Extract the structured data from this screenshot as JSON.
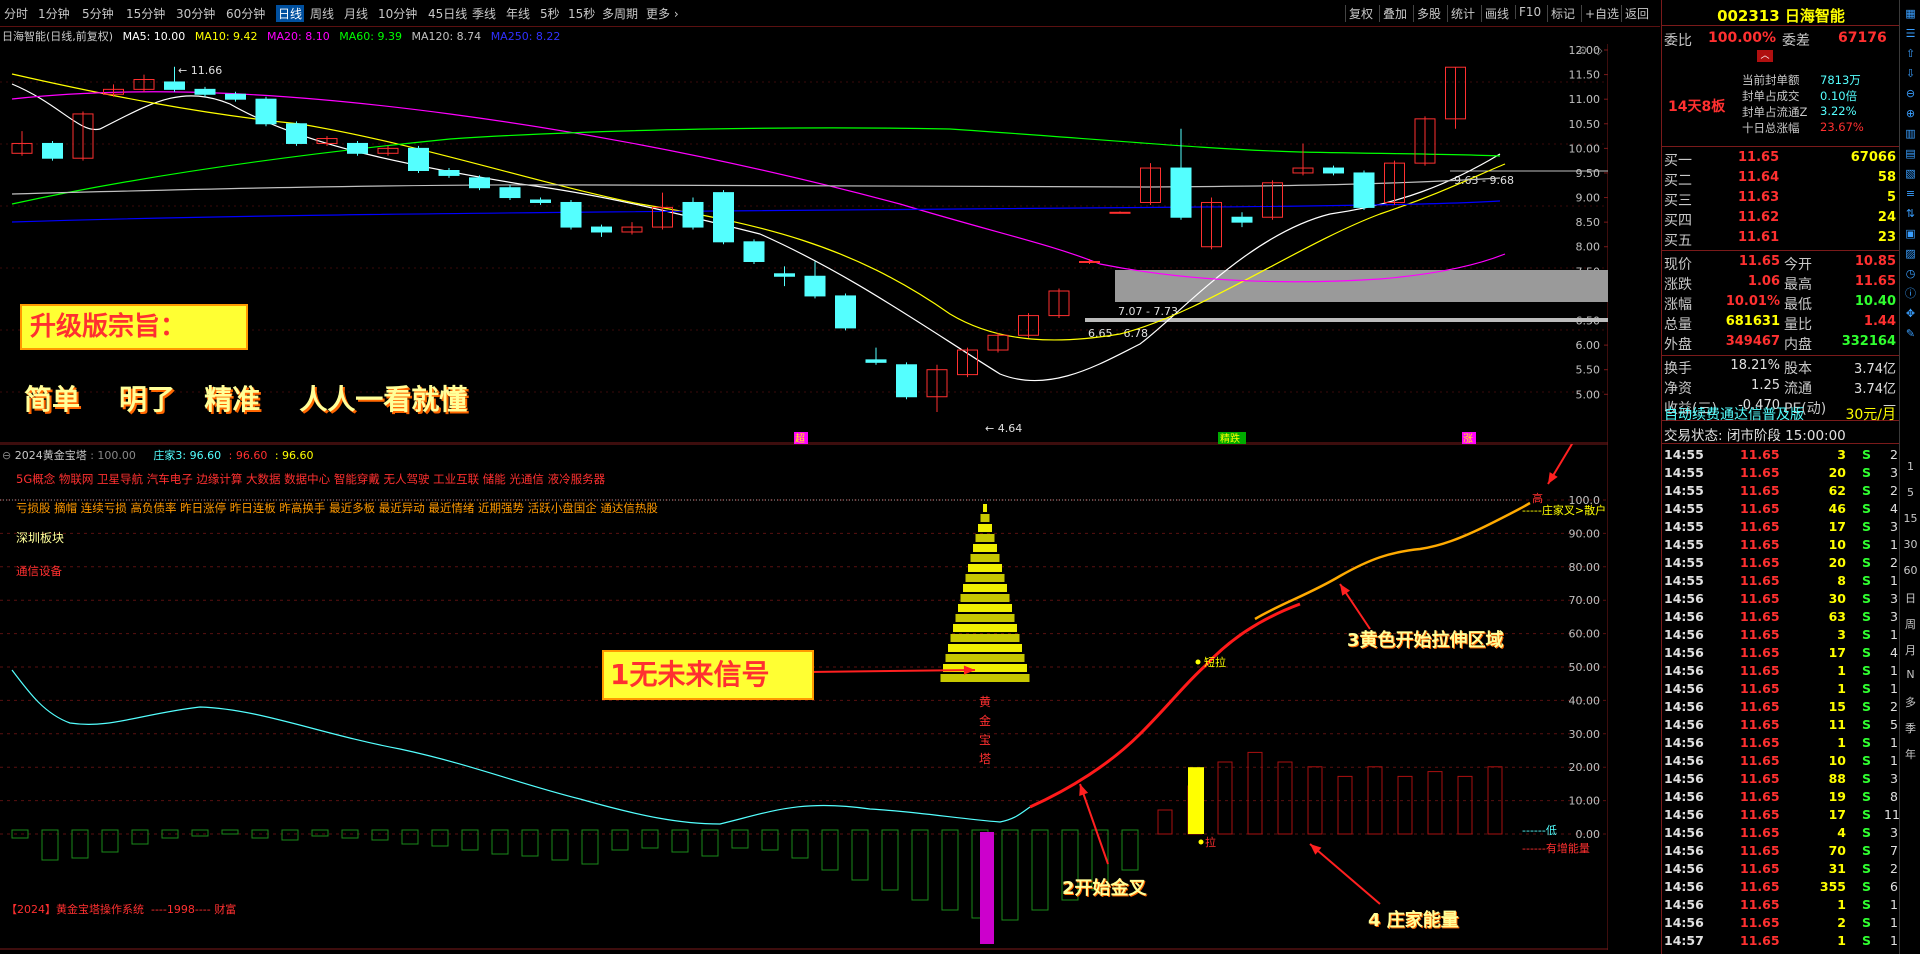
{
  "toolbar": {
    "periods": [
      "分时",
      "1分钟",
      "5分钟",
      "15分钟",
      "30分钟",
      "60分钟",
      "日线",
      "周线",
      "月线",
      "10分钟",
      "45日线",
      "季线",
      "年线",
      "5秒",
      "15秒",
      "多周期",
      "更多 ›"
    ],
    "active_period": "日线",
    "right_items": [
      "复权",
      "叠加",
      "多股",
      "统计",
      "画线",
      "F10",
      "标记",
      "+自选",
      "返回"
    ]
  },
  "main_legend": {
    "title": "日海智能(日线,前复权)",
    "ma5": "MA5: 10.00",
    "ma10": "MA10: 9.42",
    "ma20": "MA20: 8.10",
    "ma60": "MA60: 9.39",
    "ma120": "MA120: 8.74",
    "ma250": "MA250: 8.22"
  },
  "colors": {
    "ma5": "#ffffff",
    "ma10": "#ffff00",
    "ma20": "#ff00ff",
    "ma60": "#00ff00",
    "ma120": "#c0c0c0",
    "ma250": "#0000ff",
    "up": "#ff3030",
    "down": "#54ffff",
    "grid": "#7a1a1a"
  },
  "price_axis": [
    "12.00",
    "11.50",
    "11.00",
    "10.50",
    "10.00",
    "9.50",
    "9.00",
    "8.50",
    "8.00",
    "7.50",
    "7.00",
    "6.50",
    "6.00",
    "5.50",
    "5.00"
  ],
  "main_annotations": {
    "high_label": "11.66",
    "low_label": "4.64",
    "zone1": "7.07 - 7.73",
    "zone2": "6.65 - 6.78",
    "zone3": "9.63 - 9.68",
    "marker1": "超",
    "marker2": "精跌",
    "marker3": "涨"
  },
  "promo": {
    "box_title": "升级版宗旨：",
    "slogan": "简单    明了   精准    人人一看就懂"
  },
  "sub_legend": {
    "name": "2024黄金宝塔",
    "val1": ": 100.00",
    "label2": "庄家3: 96.60",
    "val3": ": 96.60",
    "val4": ": 96.60"
  },
  "concepts": {
    "line1": "5G概念 物联网 卫星导航 汽车电子 边缘计算 大数据 数据中心 智能穿戴 无人驾驶 工业互联 储能 光通信 液冷服务器",
    "line2": "亏损股 摘帽 连续亏损 高负债率 昨日涨停 昨日连板 昨高换手 最近多板 最近异动 最近情绪 近期强势 活跃小盘国企 通达信热股",
    "line3": "深圳板块",
    "line4": "通信设备"
  },
  "sub_axis": [
    "100.0",
    "90.00",
    "80.00",
    "70.00",
    "60.00",
    "50.00",
    "40.00",
    "30.00",
    "20.00",
    "10.00",
    "0.00"
  ],
  "sub_annotations": {
    "pagoda_label": [
      "黄",
      "金",
      "宝",
      "塔"
    ],
    "box1": "1无未来信号",
    "arrow2": "2开始金叉",
    "arrow3": "3黄色开始拉伸区域",
    "arrow4": "4 庄家能量",
    "short_pull": "短拉",
    "pull": "拉",
    "top_label": "高",
    "cross_label": "庄家叉>散户",
    "low_label": "低",
    "energy_label": "有增能量",
    "footer": "【2024】黄金宝塔操作系统  ----1998---- 财富"
  },
  "stock": {
    "code": "002313",
    "name": "日海智能",
    "wei_bi_label": "委比",
    "wei_bi": "100.00%",
    "wei_cha_label": "委差",
    "wei_cha": "67176",
    "seal_rows": [
      {
        "label": "当前封单额",
        "value": "7813万"
      },
      {
        "label": "封单占成交",
        "value": "0.10倍"
      },
      {
        "label": "封单占流通Z",
        "value": "3.22%"
      },
      {
        "label": "十日总涨幅",
        "value": "23.67%"
      }
    ],
    "streak": "14天8板",
    "buys": [
      {
        "label": "买一",
        "price": "11.65",
        "vol": "67066"
      },
      {
        "label": "买二",
        "price": "11.64",
        "vol": "58"
      },
      {
        "label": "买三",
        "price": "11.63",
        "vol": "5"
      },
      {
        "label": "买四",
        "price": "11.62",
        "vol": "24"
      },
      {
        "label": "买五",
        "price": "11.61",
        "vol": "23"
      }
    ],
    "quote": [
      {
        "l1": "现价",
        "v1": "11.65",
        "l2": "今开",
        "v2": "10.85"
      },
      {
        "l1": "涨跌",
        "v1": "1.06",
        "l2": "最高",
        "v2": "11.65"
      },
      {
        "l1": "涨幅",
        "v1": "10.01%",
        "l2": "最低",
        "v2": "10.40"
      },
      {
        "l1": "总量",
        "v1": "681631",
        "l2": "量比",
        "v2": "1.44"
      },
      {
        "l1": "外盘",
        "v1": "349467",
        "l2": "内盘",
        "v2": "332164"
      }
    ],
    "fund": [
      {
        "l1": "换手",
        "v1": "18.21%",
        "l2": "股本",
        "v2": "3.74亿"
      },
      {
        "l1": "净资",
        "v1": "1.25",
        "l2": "流通",
        "v2": "3.74亿"
      },
      {
        "l1": "收益(三)",
        "v1": "-0.470",
        "l2": "PE(动)",
        "v2": "—"
      }
    ],
    "promo_line": "自动续费通达信普及版",
    "promo_price": "30元/月",
    "trade_state": "交易状态: 闭市阶段 15:00:00"
  },
  "ticks": [
    [
      "14:55",
      "11.65",
      "3",
      "S",
      "2"
    ],
    [
      "14:55",
      "11.65",
      "20",
      "S",
      "3"
    ],
    [
      "14:55",
      "11.65",
      "62",
      "S",
      "2"
    ],
    [
      "14:55",
      "11.65",
      "46",
      "S",
      "4"
    ],
    [
      "14:55",
      "11.65",
      "17",
      "S",
      "3"
    ],
    [
      "14:55",
      "11.65",
      "10",
      "S",
      "1"
    ],
    [
      "14:55",
      "11.65",
      "20",
      "S",
      "2"
    ],
    [
      "14:55",
      "11.65",
      "8",
      "S",
      "1"
    ],
    [
      "14:56",
      "11.65",
      "30",
      "S",
      "3"
    ],
    [
      "14:56",
      "11.65",
      "63",
      "S",
      "3"
    ],
    [
      "14:56",
      "11.65",
      "3",
      "S",
      "1"
    ],
    [
      "14:56",
      "11.65",
      "17",
      "S",
      "4"
    ],
    [
      "14:56",
      "11.65",
      "1",
      "S",
      "1"
    ],
    [
      "14:56",
      "11.65",
      "1",
      "S",
      "1"
    ],
    [
      "14:56",
      "11.65",
      "15",
      "S",
      "2"
    ],
    [
      "14:56",
      "11.65",
      "11",
      "S",
      "5"
    ],
    [
      "14:56",
      "11.65",
      "1",
      "S",
      "1"
    ],
    [
      "14:56",
      "11.65",
      "10",
      "S",
      "1"
    ],
    [
      "14:56",
      "11.65",
      "88",
      "S",
      "3"
    ],
    [
      "14:56",
      "11.65",
      "19",
      "S",
      "8"
    ],
    [
      "14:56",
      "11.65",
      "17",
      "S",
      "11"
    ],
    [
      "14:56",
      "11.65",
      "4",
      "S",
      "3"
    ],
    [
      "14:56",
      "11.65",
      "70",
      "S",
      "7"
    ],
    [
      "14:56",
      "11.65",
      "31",
      "S",
      "2"
    ],
    [
      "14:56",
      "11.65",
      "355",
      "S",
      "6"
    ],
    [
      "14:56",
      "11.65",
      "1",
      "S",
      "1"
    ],
    [
      "14:56",
      "11.65",
      "2",
      "S",
      "1"
    ],
    [
      "14:57",
      "11.65",
      "1",
      "S",
      "1"
    ]
  ],
  "far_right": [
    "1",
    "5",
    "15",
    "30",
    "60",
    "日",
    "周",
    "月",
    "N",
    "多",
    "季",
    "年"
  ],
  "chart_data": {
    "type": "candlestick",
    "ma_legend": [
      "MA5",
      "MA10",
      "MA20",
      "MA60",
      "MA120",
      "MA250"
    ],
    "candles": [
      {
        "o": 9.9,
        "c": 10.1,
        "h": 10.35,
        "l": 9.85
      },
      {
        "o": 10.1,
        "c": 9.8,
        "h": 10.15,
        "l": 9.75
      },
      {
        "o": 9.8,
        "c": 10.7,
        "h": 10.75,
        "l": 9.75
      },
      {
        "o": 11.1,
        "c": 11.2,
        "h": 11.3,
        "l": 11.05
      },
      {
        "o": 11.2,
        "c": 11.4,
        "h": 11.5,
        "l": 11.15
      },
      {
        "o": 11.35,
        "c": 11.2,
        "h": 11.66,
        "l": 11.15
      },
      {
        "o": 11.2,
        "c": 11.1,
        "h": 11.25,
        "l": 11.05
      },
      {
        "o": 11.1,
        "c": 11.0,
        "h": 11.15,
        "l": 10.95
      },
      {
        "o": 11.0,
        "c": 10.5,
        "h": 11.05,
        "l": 10.45
      },
      {
        "o": 10.5,
        "c": 10.1,
        "h": 10.55,
        "l": 10.05
      },
      {
        "o": 10.1,
        "c": 10.2,
        "h": 10.25,
        "l": 10.05
      },
      {
        "o": 10.1,
        "c": 9.9,
        "h": 10.15,
        "l": 9.85
      },
      {
        "o": 9.9,
        "c": 10.0,
        "h": 10.05,
        "l": 9.85
      },
      {
        "o": 10.0,
        "c": 9.55,
        "h": 10.05,
        "l": 9.5
      },
      {
        "o": 9.55,
        "c": 9.45,
        "h": 9.6,
        "l": 9.4
      },
      {
        "o": 9.4,
        "c": 9.2,
        "h": 9.45,
        "l": 9.15
      },
      {
        "o": 9.2,
        "c": 9.0,
        "h": 9.25,
        "l": 8.95
      },
      {
        "o": 8.95,
        "c": 8.9,
        "h": 9.0,
        "l": 8.85
      },
      {
        "o": 8.9,
        "c": 8.4,
        "h": 8.95,
        "l": 8.35
      },
      {
        "o": 8.4,
        "c": 8.3,
        "h": 8.45,
        "l": 8.2
      },
      {
        "o": 8.3,
        "c": 8.4,
        "h": 8.5,
        "l": 8.25
      },
      {
        "o": 8.4,
        "c": 8.8,
        "h": 9.1,
        "l": 8.35
      },
      {
        "o": 8.9,
        "c": 8.4,
        "h": 9.0,
        "l": 8.35
      },
      {
        "o": 9.1,
        "c": 8.1,
        "h": 9.15,
        "l": 8.05
      },
      {
        "o": 8.1,
        "c": 7.7,
        "h": 8.15,
        "l": 7.65
      },
      {
        "o": 7.45,
        "c": 7.4,
        "h": 7.6,
        "l": 7.2
      },
      {
        "o": 7.4,
        "c": 7.0,
        "h": 7.7,
        "l": 6.95
      },
      {
        "o": 7.0,
        "c": 6.35,
        "h": 7.05,
        "l": 6.3
      },
      {
        "o": 5.7,
        "c": 5.65,
        "h": 5.95,
        "l": 5.6
      },
      {
        "o": 5.6,
        "c": 4.95,
        "h": 5.65,
        "l": 4.9
      },
      {
        "o": 4.95,
        "c": 5.5,
        "h": 5.6,
        "l": 4.64
      },
      {
        "o": 5.4,
        "c": 5.9,
        "h": 5.95,
        "l": 5.35
      },
      {
        "o": 5.9,
        "c": 6.2,
        "h": 6.25,
        "l": 5.85
      },
      {
        "o": 6.2,
        "c": 6.6,
        "h": 6.65,
        "l": 6.15
      },
      {
        "o": 6.6,
        "c": 7.1,
        "h": 7.15,
        "l": 6.55
      },
      {
        "o": 7.7,
        "c": 7.7,
        "h": 7.75,
        "l": 7.65
      },
      {
        "o": 8.7,
        "c": 8.7,
        "h": 8.72,
        "l": 8.68
      },
      {
        "o": 8.9,
        "c": 9.6,
        "h": 9.7,
        "l": 8.85
      },
      {
        "o": 9.6,
        "c": 8.6,
        "h": 10.4,
        "l": 8.55
      },
      {
        "o": 8.0,
        "c": 8.9,
        "h": 9.0,
        "l": 7.95
      },
      {
        "o": 8.6,
        "c": 8.5,
        "h": 8.7,
        "l": 8.4
      },
      {
        "o": 8.6,
        "c": 9.3,
        "h": 9.35,
        "l": 8.55
      },
      {
        "o": 9.5,
        "c": 9.6,
        "h": 10.1,
        "l": 9.45
      },
      {
        "o": 9.6,
        "c": 9.5,
        "h": 9.65,
        "l": 9.45
      },
      {
        "o": 9.5,
        "c": 8.8,
        "h": 9.55,
        "l": 8.75
      },
      {
        "o": 8.9,
        "c": 9.7,
        "h": 9.75,
        "l": 8.85
      },
      {
        "o": 9.7,
        "c": 10.6,
        "h": 10.65,
        "l": 9.65
      },
      {
        "o": 10.6,
        "c": 11.65,
        "h": 11.65,
        "l": 10.4
      }
    ]
  }
}
